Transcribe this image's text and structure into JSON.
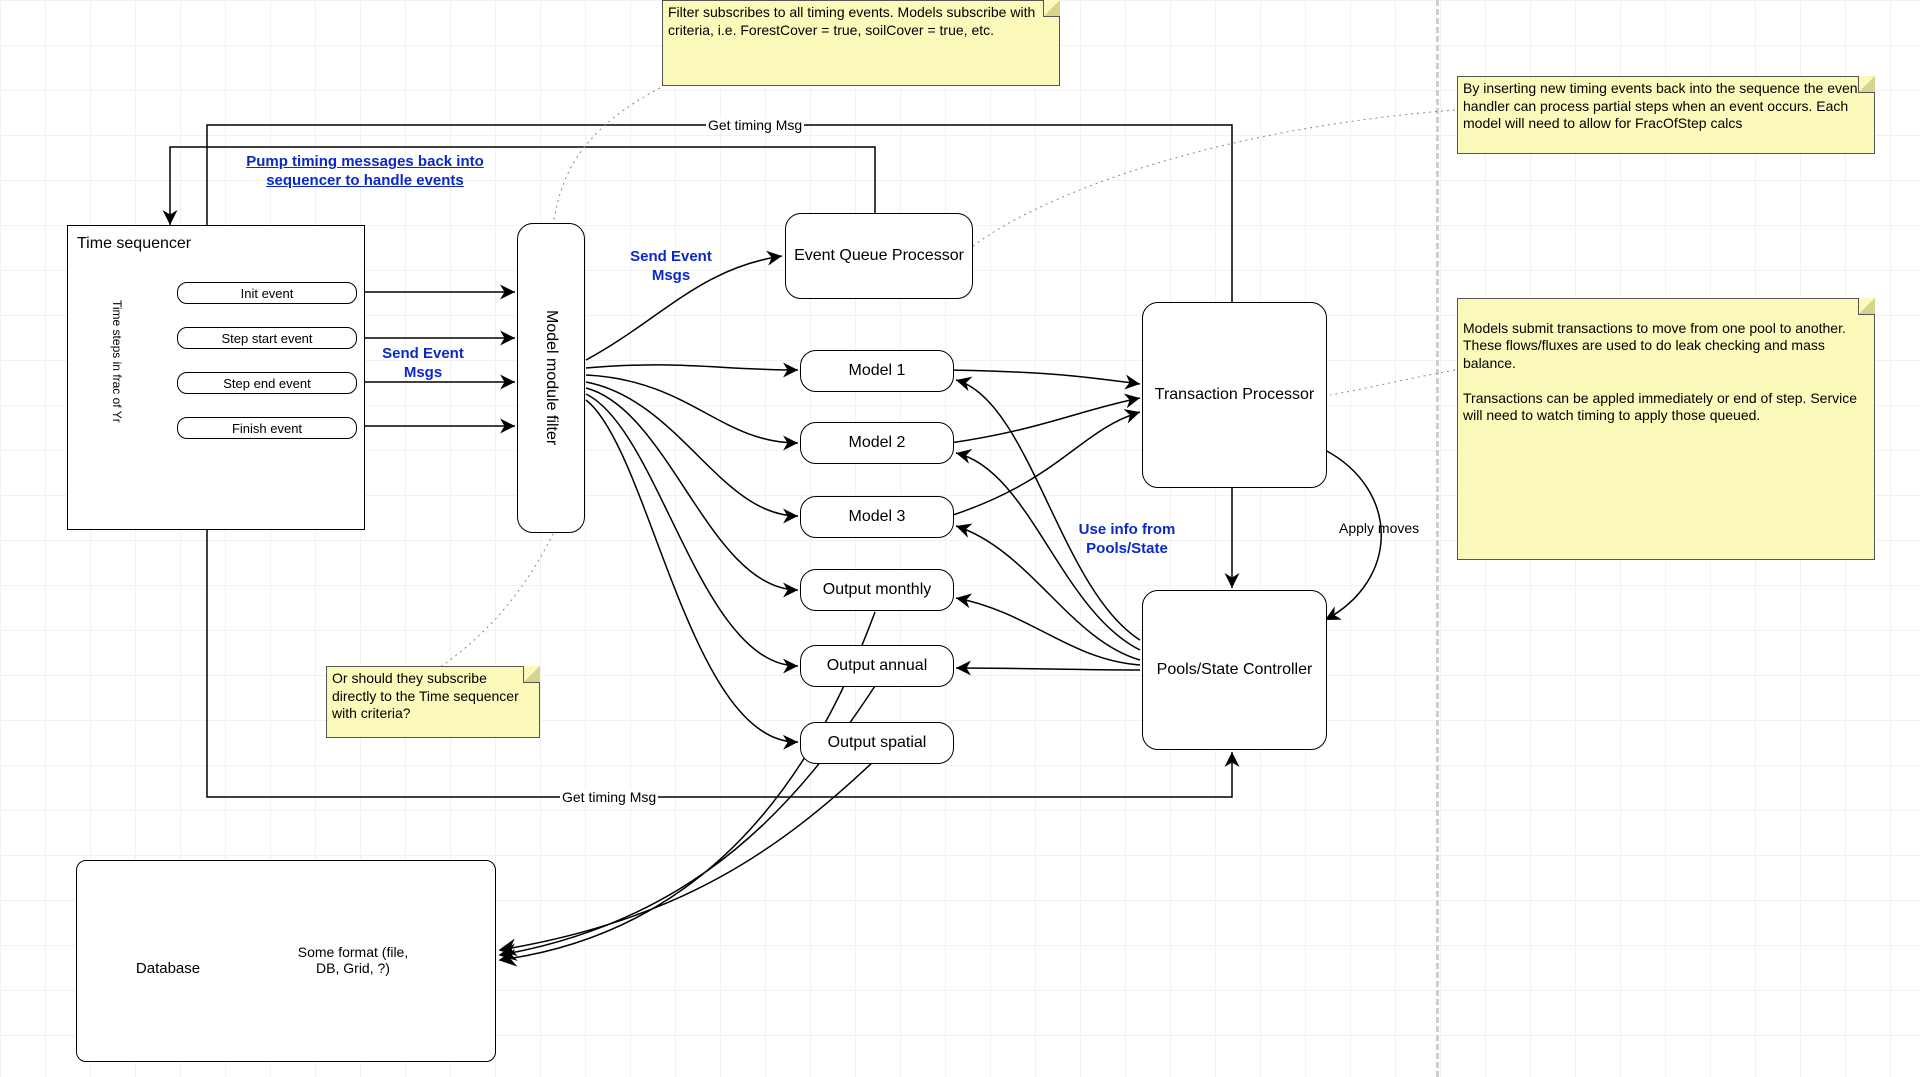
{
  "notes": {
    "filter_sub": "Filter subscribes to all timing events. Models subscribe with criteria, i.e. ForestCover = true, soilCover = true, etc.",
    "insert_timing": "By inserting new timing events back into the sequence the event handler can process partial steps when an event occurs. Each model will need to allow for FracOfStep calcs",
    "transactions": "Models submit transactions to move from one pool to another. These flows/fluxes are used to do leak checking and mass balance.\n\nTransactions can be appled immediately or end of step. Service will need to watch timing to apply those queued.",
    "subscribe_direct": "Or should they subscribe directly to the Time sequencer with criteria?"
  },
  "boxes": {
    "time_sequencer": "Time sequencer",
    "time_steps": "Time steps in frac of Yr",
    "filter": "Model module filter",
    "eqp": "Event Queue Processor",
    "model1": "Model 1",
    "model2": "Model 2",
    "model3": "Model 3",
    "out_monthly": "Output monthly",
    "out_annual": "Output annual",
    "out_spatial": "Output spatial",
    "tp": "Transaction Processor",
    "psc": "Pools/State Controller",
    "database": "Database",
    "doc": "Some format (file, DB, Grid, ?)"
  },
  "events": {
    "init": "Init event",
    "step_start": "Step start event",
    "step_end": "Step end event",
    "finish": "Finish event"
  },
  "blue": {
    "pump": "Pump timing messages back into sequencer to handle events",
    "send1": "Send Event Msgs",
    "send2": "Send Event Msgs",
    "use_info": "Use info from Pools/State"
  },
  "labels": {
    "get_timing": "Get timing Msg",
    "apply_moves": "Apply moves"
  }
}
